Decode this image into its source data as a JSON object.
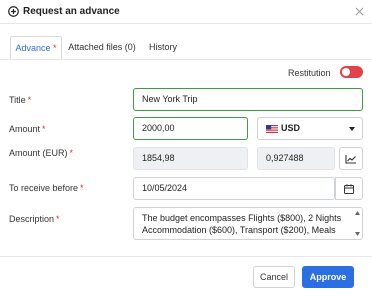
{
  "dialog": {
    "title": "Request an advance",
    "icons": {
      "header": "plus-circle-icon",
      "close": "close-icon"
    }
  },
  "tabs": [
    {
      "label": "Advance",
      "required_mark": "*",
      "active": true
    },
    {
      "label": "Attached files (0)",
      "active": false
    },
    {
      "label": "History",
      "active": false
    }
  ],
  "restitution": {
    "label": "Restitution",
    "enabled": true,
    "toggle_color": "#e2434b"
  },
  "form": {
    "title": {
      "label": "Title",
      "required_mark": "*",
      "value": "New York Trip"
    },
    "amount": {
      "label": "Amount",
      "required_mark": "*",
      "value": "2000,00",
      "currency": {
        "code": "USD",
        "flag": "us-flag-icon"
      }
    },
    "amount_eur": {
      "label": "Amount (EUR)",
      "required_mark": "*",
      "value": "1854,98",
      "rate": "0,927488"
    },
    "receive_before": {
      "label": "To receive before",
      "required_mark": "*",
      "value": "10/05/2024"
    },
    "description": {
      "label": "Description",
      "required_mark": "*",
      "value": "The budget encompasses Flights ($800), 2 Nights Accommodation ($600), Transport ($200), Meals"
    }
  },
  "footer": {
    "cancel_label": "Cancel",
    "approve_label": "Approve"
  },
  "colors": {
    "accent": "#2c6fe0",
    "required": "#d3343c",
    "focus_border": "#3e9b45"
  }
}
